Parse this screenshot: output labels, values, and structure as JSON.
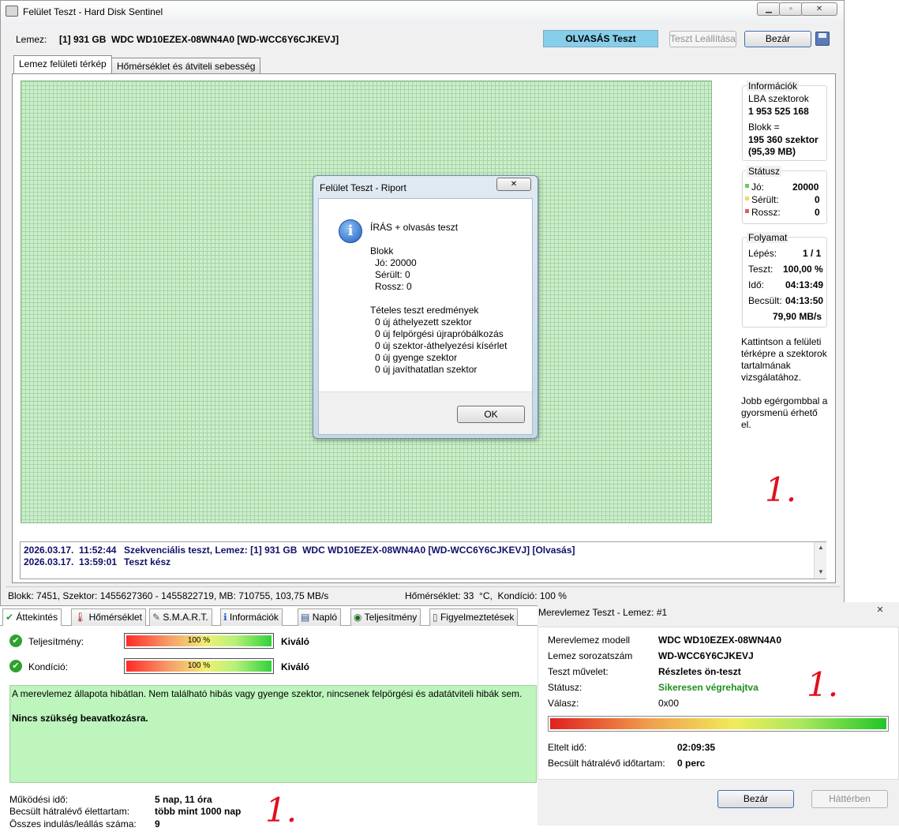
{
  "main_window": {
    "title": "Felület Teszt - Hard Disk Sentinel",
    "min_glyph": "▁",
    "max_glyph": "▫",
    "close_glyph": "✕",
    "disk_label": "Lemez:",
    "disk_value": "[1] 931 GB  WDC WD10EZEX-08WN4A0 [WD-WCC6Y6CJKEVJ]",
    "mode_label": "OLVASÁS Teszt",
    "stop_button": "Teszt Leállítása",
    "close_button": "Bezár",
    "accent_color": "#87ceeb"
  },
  "tabs": [
    {
      "label": "Lemez felületi térkép"
    },
    {
      "label": "Hőmérséklet és átviteli sebesség"
    }
  ],
  "info_panel": {
    "title": "Információk",
    "lba_label": "LBA szektorok",
    "lba_value": "1 953 525 168",
    "block_label": "Blokk =",
    "block_value": "195 360 szektor",
    "block_mb": "(95,39 MB)"
  },
  "status_panel": {
    "title": "Státusz",
    "items": [
      {
        "label": "Jó:",
        "value": "20000",
        "color": "#66cc66"
      },
      {
        "label": "Sérült:",
        "value": "0",
        "color": "#e8e060"
      },
      {
        "label": "Rossz:",
        "value": "0",
        "color": "#e06060"
      }
    ]
  },
  "progress_panel": {
    "title": "Folyamat",
    "rows": [
      {
        "label": "Lépés:",
        "value": "1 / 1"
      },
      {
        "label": "Teszt:",
        "value": "100,00 %"
      },
      {
        "label": "Idő:",
        "value": "04:13:49"
      },
      {
        "label": "Becsült:",
        "value": "04:13:50"
      }
    ],
    "speed": "79,90 MB/s"
  },
  "hints": {
    "hint1": "Kattintson a felületi térképre a szektorok tartalmának vizsgálatához.",
    "hint2": "Jobb egérgombbal a gyorsmenü érhető el."
  },
  "marks": {
    "mark1": "1.",
    "mark2": "1.",
    "mark3": "1."
  },
  "dialog": {
    "title": "Felület Teszt - Riport",
    "close_glyph": "✕",
    "info_glyph": "i",
    "line1": "ÍRÁS + olvasás teszt",
    "block_title": "Blokk",
    "good": "Jó: 20000",
    "damaged": "Sérült: 0",
    "bad": "Rossz: 0",
    "results_title": "Tételes teszt eredmények",
    "r1": "0 új áthelyezett szektor",
    "r2": "0 új felpörgési újrapróbálkozás",
    "r3": "0 új szektor-áthelyezési kísérlet",
    "r4": "0 új gyenge szektor",
    "r5": "0 új javíthatatlan szektor",
    "ok_button": "OK"
  },
  "log": {
    "line1_date": "2026.03.17.  11:52:44",
    "line1_text": "Szekvenciális teszt, Lemez: [1] 931 GB  WDC WD10EZEX-08WN4A0 [WD-WCC6Y6CJKEVJ] [Olvasás]",
    "line2_date": "2026.03.17.  13:59:01",
    "line2_text": "Teszt kész",
    "scroll_up": "▲",
    "scroll_down": "▼"
  },
  "statusbar": {
    "left": "Blokk: 7451, Szektor: 1455627360 - 1455822719, MB: 710755, 103,75 MB/s",
    "right": "Hőmérséklet: 33  °C,  Kondíció: 100 %"
  },
  "bottom_tabs": [
    {
      "label": "Áttekintés",
      "icon": "check-icon",
      "glyph": "✔"
    },
    {
      "label": "Hőmérséklet",
      "icon": "thermometer-icon",
      "glyph": "🌡"
    },
    {
      "label": "S.M.A.R.T.",
      "icon": "smart-icon",
      "glyph": "✎"
    },
    {
      "label": "Információk",
      "icon": "info-icon",
      "glyph": "ℹ"
    },
    {
      "label": "Napló",
      "icon": "log-icon",
      "glyph": "▤"
    },
    {
      "label": "Teljesítmény",
      "icon": "gauge-icon",
      "glyph": "◉"
    },
    {
      "label": "Figyelmeztetések",
      "icon": "document-icon",
      "glyph": "▯"
    }
  ],
  "overview": {
    "perf_label": "Teljesítmény:",
    "perf_value": "100 %",
    "perf_fraction": 1.0,
    "perf_rating": "Kiváló",
    "cond_label": "Kondíció:",
    "cond_value": "100 %",
    "cond_fraction": 1.0,
    "cond_rating": "Kiváló",
    "check_glyph": "✔",
    "health_text": "A merevlemez állapota hibátlan. Nem található hibás vagy gyenge szektor, nincsenek felpörgési és adatátviteli hibák sem.",
    "health_action": "Nincs szükség beavatkozásra.",
    "uptime_label": "Működési idő:",
    "uptime_value": "5 nap, 11 óra",
    "life_label": "Becsült hátralévő élettartam:",
    "life_value": "több mint 1000 nap",
    "starts_label": "Összes indulás/leállás száma:",
    "starts_value": "9"
  },
  "selftest": {
    "title": "Merevlemez Teszt - Lemez: #1",
    "close_glyph": "✕",
    "model_label": "Merevlemez modell",
    "model_value": "WDC WD10EZEX-08WN4A0",
    "serial_label": "Lemez sorozatszám",
    "serial_value": "WD-WCC6Y6CJKEVJ",
    "op_label": "Teszt művelet:",
    "op_value": "Részletes ön-teszt",
    "status_label": "Státusz:",
    "status_value": "Sikeresen végrehajtva",
    "status_color": "#1f8f1f",
    "resp_label": "Válasz:",
    "resp_value": "0x00",
    "progress_fraction": 1.0,
    "elapsed_label": "Eltelt idő:",
    "elapsed_value": "02:09:35",
    "remaining_label": "Becsült hátralévő időtartam:",
    "remaining_value": "0 perc",
    "close_button": "Bezár",
    "background_button": "Háttérben"
  }
}
